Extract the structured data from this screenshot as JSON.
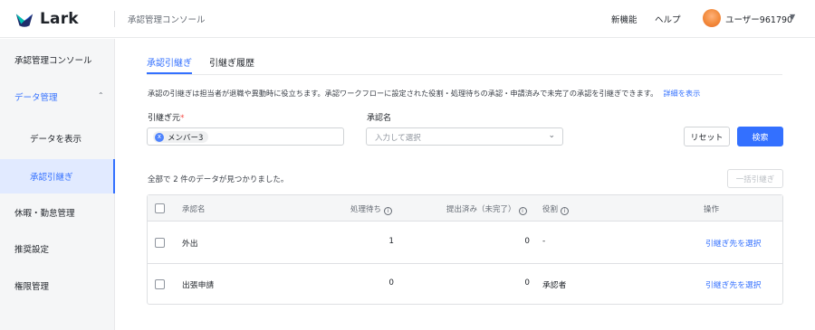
{
  "header": {
    "logo_text": "Lark",
    "app_title": "承認管理コンソール",
    "new_features": "新機能",
    "help": "ヘルプ",
    "user_name": "ユーザー961790",
    "user_caret": "▼"
  },
  "sidebar": {
    "items": [
      {
        "label": "承認管理コンソール"
      },
      {
        "label": "データ管理",
        "caret": "⌃"
      },
      {
        "label": "データを表示"
      },
      {
        "label": "承認引継ぎ"
      },
      {
        "label": "休暇・勤怠管理"
      },
      {
        "label": "推奨設定"
      },
      {
        "label": "権限管理"
      }
    ]
  },
  "tabs": [
    {
      "label": "承認引継ぎ"
    },
    {
      "label": "引継ぎ履歴"
    }
  ],
  "description": {
    "text": "承認の引継ぎは担当者が退職や異動時に役立ちます。承認ワークフローに設定された役割・処理待ちの承認・申請済みで未完了の承認を引継ぎできます。",
    "link": "詳細を表示"
  },
  "form": {
    "source_label": "引継ぎ元",
    "required_mark": "*",
    "source_tag_icon": "x",
    "source_tag": "メンバー3",
    "approval_label": "承認名",
    "approval_placeholder": "入力して選択",
    "reset_button": "リセット",
    "search_button": "検索"
  },
  "results": {
    "count_text": "全部で 2 件のデータが見つかりました。",
    "bulk_button": "一括引継ぎ"
  },
  "table": {
    "headers": {
      "name": "承認名",
      "pending": "処理待ち",
      "submitted": "提出済み（未完了）",
      "role": "役割",
      "action": "操作",
      "info_glyph": "i"
    },
    "rows": [
      {
        "name": "外出",
        "pending": "1",
        "submitted": "0",
        "role": "-",
        "action": "引継ぎ先を選択"
      },
      {
        "name": "出張申請",
        "pending": "0",
        "submitted": "0",
        "role": "承認者",
        "action": "引継ぎ先を選択"
      }
    ]
  },
  "colors": {
    "accent": "#3370ff",
    "sidebar_bg": "#f5f6f7",
    "selected_bg": "#e1eaff"
  }
}
